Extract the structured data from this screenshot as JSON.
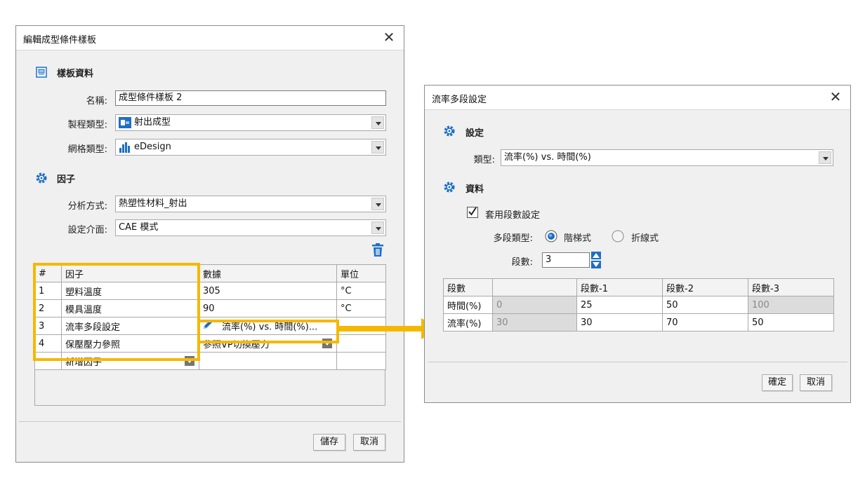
{
  "left_dialog": {
    "title": "編輯成型條件樣板",
    "close_glyph": "✕",
    "template_section": {
      "title": "樣板資料",
      "icon": "template-icon"
    },
    "name_label": "名稱:",
    "name_value": "成型條件樣板 2",
    "process_label": "製程類型:",
    "process_value": "射出成型",
    "mesh_label": "網格類型:",
    "mesh_value": "eDesign",
    "factor_section": {
      "title": "因子",
      "icon": "gear-icon"
    },
    "analysis_label": "分析方式:",
    "analysis_value": "熱塑性材料_射出",
    "interface_label": "設定介面:",
    "interface_value": "CAE 模式",
    "table": {
      "headers": [
        "#",
        "因子",
        "數據",
        "單位"
      ],
      "rows": [
        {
          "num": "1",
          "factor": "塑料溫度",
          "data": "305",
          "unit": "°C"
        },
        {
          "num": "2",
          "factor": "模具溫度",
          "data": "90",
          "unit": "°C"
        },
        {
          "num": "3",
          "factor": "流率多段設定",
          "data": "流率(%) vs. 時間(%)...",
          "unit": ""
        },
        {
          "num": "4",
          "factor": "保壓壓力參照",
          "data": "參照VP切換壓力",
          "unit": ""
        }
      ],
      "add_factor": "新增因子"
    },
    "save_button": "儲存",
    "cancel_button": "取消"
  },
  "right_dialog": {
    "title": "流率多段設定",
    "close_glyph": "✕",
    "settings_section": {
      "title": "設定",
      "icon": "gear-icon"
    },
    "type_label": "類型:",
    "type_value": "流率(%) vs. 時間(%)",
    "data_section": {
      "title": "資料",
      "icon": "gear-icon"
    },
    "apply_checkbox_label": "套用段數設定",
    "apply_checked": true,
    "multi_type_label": "多段類型:",
    "radio_step": "階梯式",
    "radio_polyline": "折線式",
    "selected_type": "階梯式",
    "segments_label": "段數:",
    "segments_value": "3",
    "table": {
      "headers": [
        "段數",
        "",
        "段數-1",
        "段數-2",
        "段數-3"
      ],
      "rows": [
        {
          "label": "時間(%)",
          "values": [
            "0",
            "25",
            "50",
            "100"
          ]
        },
        {
          "label": "流率(%)",
          "values": [
            "30",
            "30",
            "70",
            "50"
          ]
        }
      ]
    },
    "ok_button": "確定",
    "cancel_button": "取消"
  },
  "colors": {
    "highlight": "#f5b800",
    "accent_blue": "#1e6fc4",
    "dialog_bg": "#f0f0f0"
  }
}
